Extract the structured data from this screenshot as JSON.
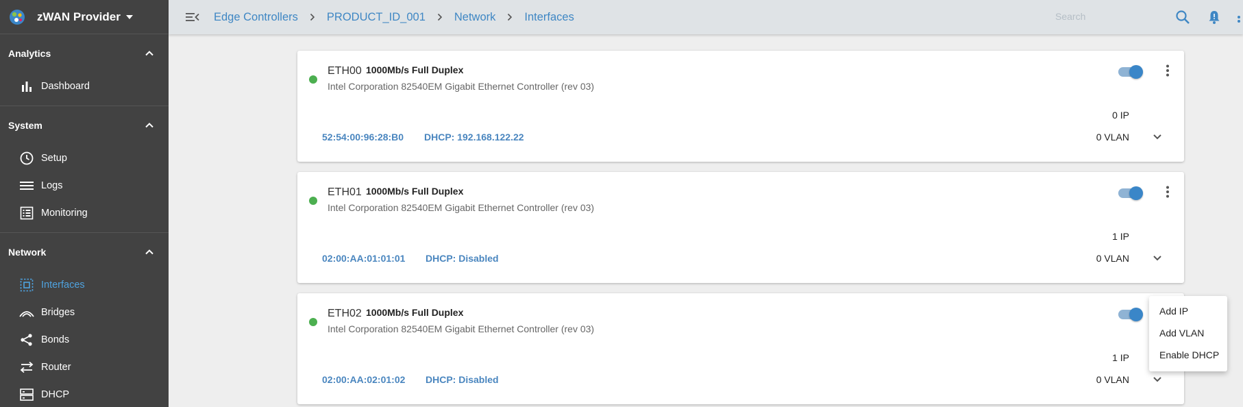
{
  "brand": {
    "name": "zWAN Provider"
  },
  "sidebar": {
    "sections": [
      {
        "title": "Analytics",
        "items": [
          {
            "label": "Dashboard",
            "icon": "bar-chart-icon"
          }
        ]
      },
      {
        "title": "System",
        "items": [
          {
            "label": "Setup",
            "icon": "clock-icon"
          },
          {
            "label": "Logs",
            "icon": "list-icon"
          },
          {
            "label": "Monitoring",
            "icon": "checklist-icon"
          }
        ]
      },
      {
        "title": "Network",
        "items": [
          {
            "label": "Interfaces",
            "icon": "interfaces-icon",
            "active": true
          },
          {
            "label": "Bridges",
            "icon": "bridge-icon"
          },
          {
            "label": "Bonds",
            "icon": "share-icon"
          },
          {
            "label": "Router",
            "icon": "swap-icon"
          },
          {
            "label": "DHCP",
            "icon": "server-icon"
          }
        ]
      }
    ]
  },
  "breadcrumb": [
    "Edge Controllers",
    "PRODUCT_ID_001",
    "Network",
    "Interfaces"
  ],
  "search": {
    "placeholder": "Search",
    "value": ""
  },
  "interfaces": [
    {
      "name": "ETH00",
      "speed": "1000Mb/s Full Duplex",
      "description": "Intel Corporation 82540EM Gigabit Ethernet Controller (rev 03)",
      "mac": "52:54:00:96:28:B0",
      "dhcp": "DHCP: 192.168.122.22",
      "ip_count": "0 IP",
      "vlan_count": "0 VLAN",
      "enabled": true
    },
    {
      "name": "ETH01",
      "speed": "1000Mb/s Full Duplex",
      "description": "Intel Corporation 82540EM Gigabit Ethernet Controller (rev 03)",
      "mac": "02:00:AA:01:01:01",
      "dhcp": "DHCP: Disabled",
      "ip_count": "1 IP",
      "vlan_count": "0 VLAN",
      "enabled": true
    },
    {
      "name": "ETH02",
      "speed": "1000Mb/s Full Duplex",
      "description": "Intel Corporation 82540EM Gigabit Ethernet Controller (rev 03)",
      "mac": "02:00:AA:02:01:02",
      "dhcp": "DHCP: Disabled",
      "ip_count": "1 IP",
      "vlan_count": "0 VLAN",
      "enabled": true
    }
  ],
  "context_menu": {
    "items": [
      "Add IP",
      "Add VLAN",
      "Enable DHCP"
    ]
  },
  "colors": {
    "sidebar_bg": "#424242",
    "accent": "#3f87c4",
    "status_up": "#4caf50",
    "topbar_bg": "#dfe3e6"
  }
}
